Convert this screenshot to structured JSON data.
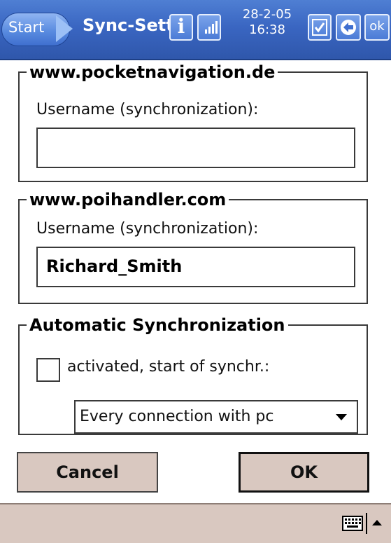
{
  "titlebar": {
    "start_label": "Start",
    "app_title": "Sync-Sett",
    "info_label": "i",
    "date": "28-2-05",
    "time": "16:38",
    "ok_label": "ok"
  },
  "groups": {
    "pocketnavigation": {
      "title": "www.pocketnavigation.de",
      "field_label": "Username (synchronization):",
      "value": ""
    },
    "poihandler": {
      "title": "www.poihandler.com",
      "field_label": "Username (synchronization):",
      "value": "Richard_Smith"
    },
    "auto_sync": {
      "title": "Automatic Synchronization",
      "checkbox_label": "activated, start of synchr.:",
      "checked": false,
      "select_value": "Every connection with pc"
    }
  },
  "buttons": {
    "cancel_label": "Cancel",
    "ok_label": "OK"
  },
  "colors": {
    "titlebar": "#3a66c2",
    "button_bg": "#d9c8c0",
    "bottombar": "#d9c8c0"
  },
  "icons": [
    "start-arrow-icon",
    "info-icon",
    "signal-icon",
    "checklist-icon",
    "back-icon",
    "keyboard-icon",
    "up-arrow-icon"
  ]
}
